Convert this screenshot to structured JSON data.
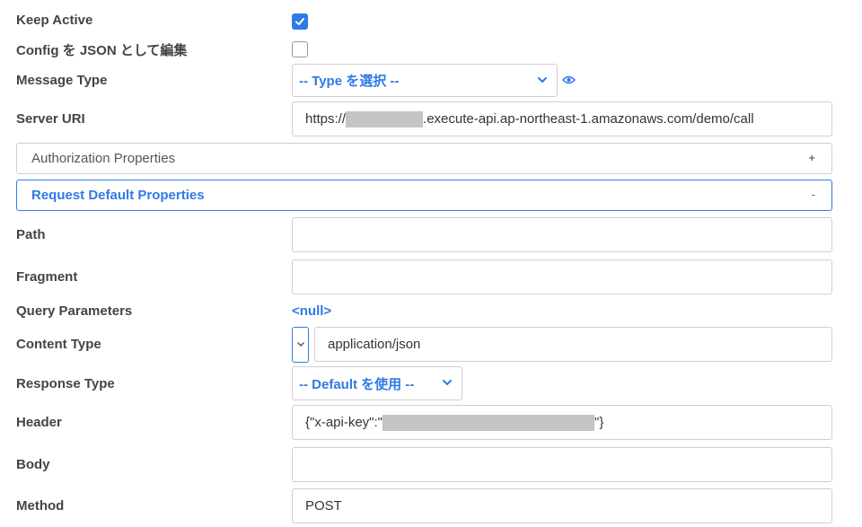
{
  "fields": {
    "keep_active": {
      "label": "Keep Active",
      "checked": true
    },
    "config_json": {
      "label": "Config を JSON として編集",
      "checked": false
    },
    "message_type": {
      "label": "Message Type",
      "select_value": "-- Type を選択 --",
      "icon": "eye-icon"
    },
    "server_uri": {
      "label": "Server URI",
      "value_prefix": "https://",
      "value_suffix": ".execute-api.ap-northeast-1.amazonaws.com/demo/call"
    },
    "path": {
      "label": "Path",
      "value": ""
    },
    "fragment": {
      "label": "Fragment",
      "value": ""
    },
    "query_parameters": {
      "label": "Query Parameters",
      "value": "<null>"
    },
    "content_type": {
      "label": "Content Type",
      "value": "application/json"
    },
    "response_type": {
      "label": "Response Type",
      "select_value": "-- Default を使用 --"
    },
    "header": {
      "label": "Header",
      "value_prefix": "{\"x-api-key\":\"",
      "value_suffix": "\"}"
    },
    "body": {
      "label": "Body",
      "value": ""
    },
    "method": {
      "label": "Method",
      "value": "POST"
    }
  },
  "panels": {
    "authorization": {
      "title": "Authorization Properties",
      "toggle": "+"
    },
    "request_default": {
      "title": "Request Default Properties",
      "toggle": "-"
    }
  },
  "colors": {
    "accent": "#2f7ae5",
    "border": "#cfcfcf",
    "mask": "#c4c4c4"
  }
}
